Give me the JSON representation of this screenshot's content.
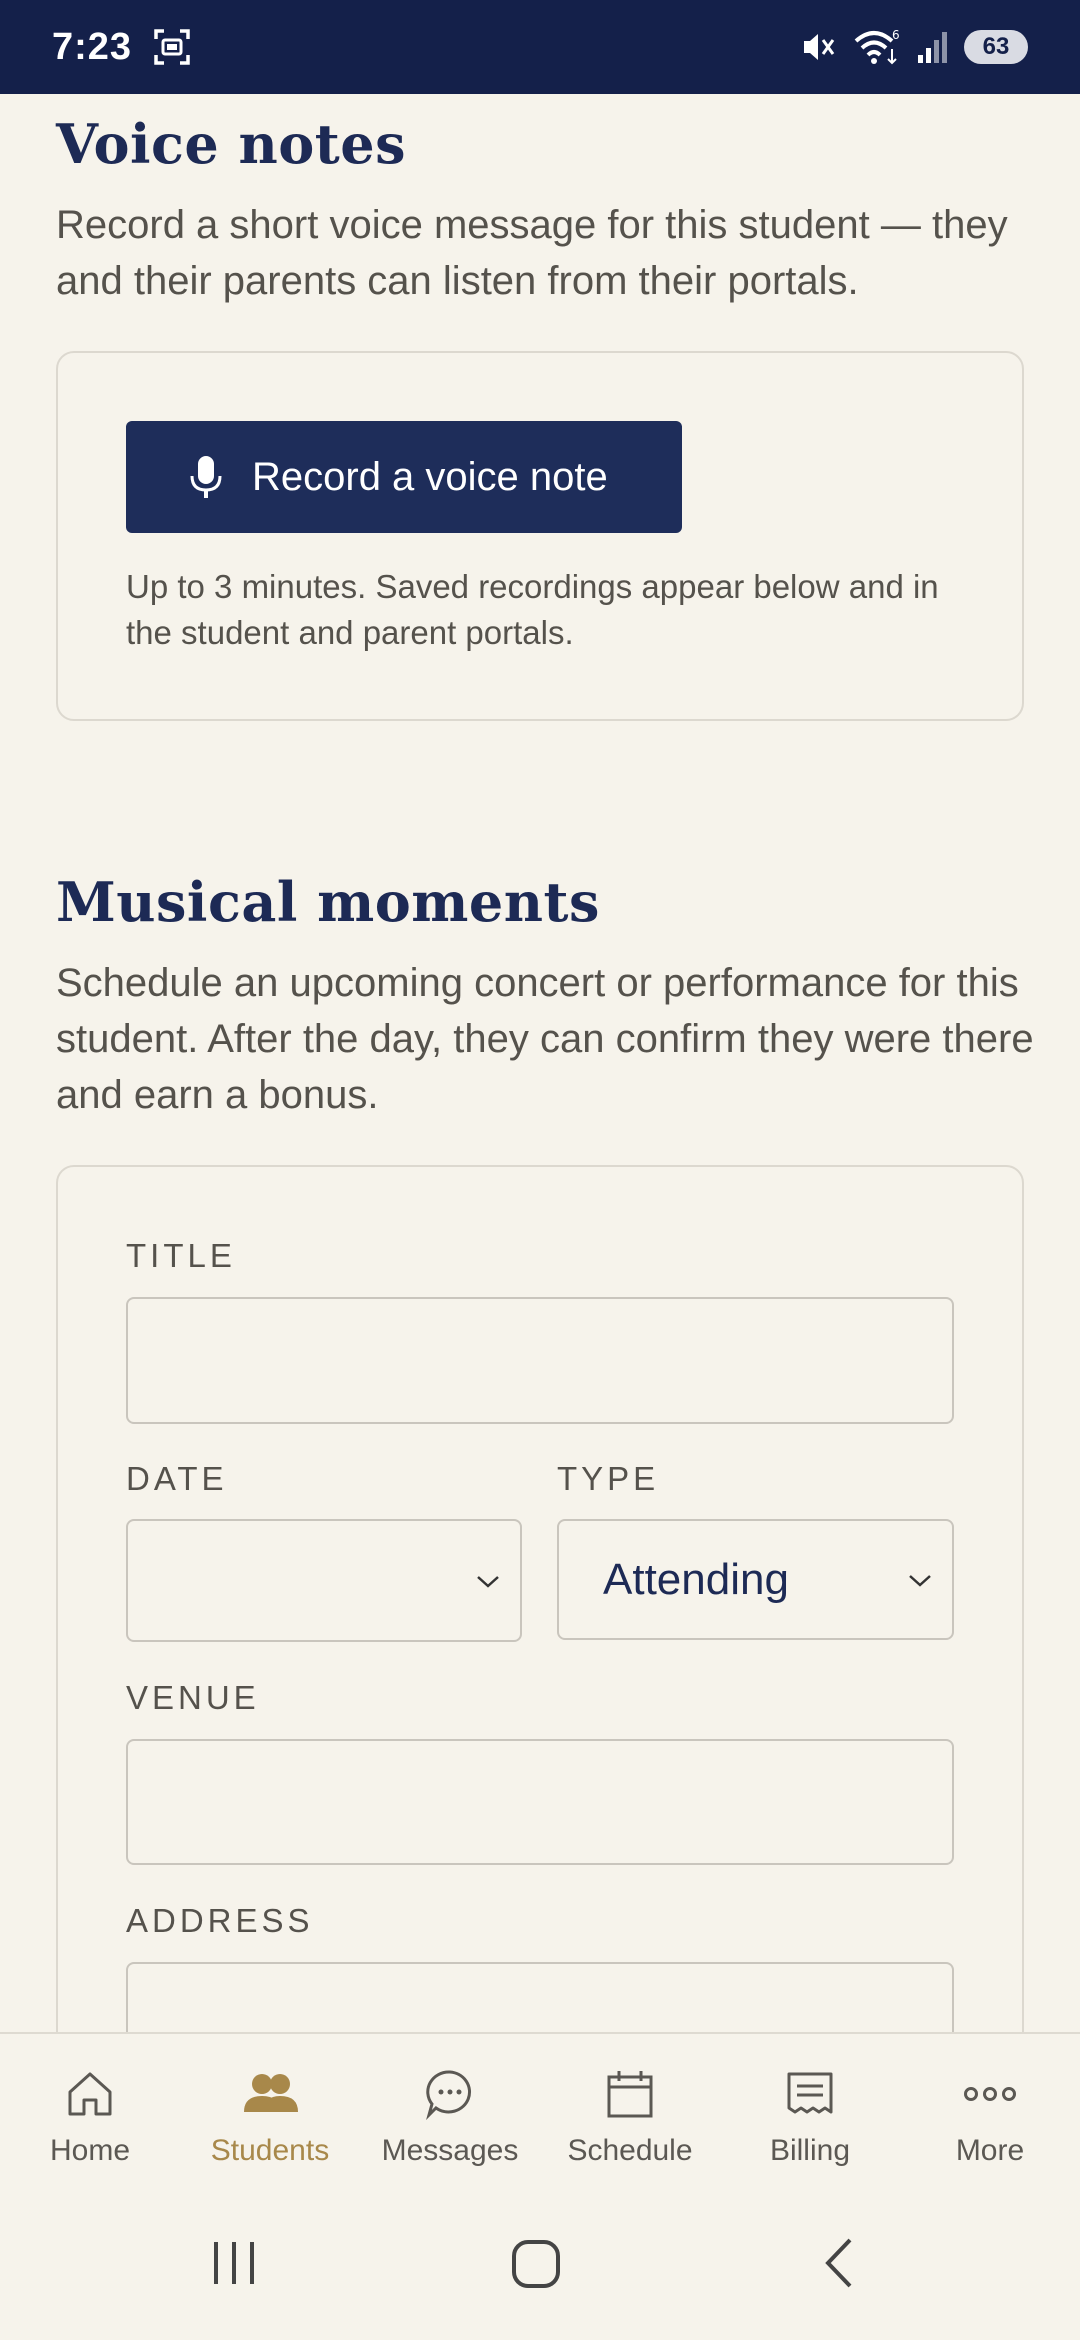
{
  "status_bar": {
    "time": "7:23",
    "battery": "63"
  },
  "voice_notes": {
    "title": "Voice notes",
    "description": "Record a short voice message for this student — they and their parents can listen from their portals.",
    "record_button": "Record a voice note",
    "hint": "Up to 3 minutes. Saved recordings appear below and in the student and parent portals."
  },
  "musical_moments": {
    "title": "Musical moments",
    "description": "Schedule an upcoming concert or performance for this student. After the day, they can confirm they were there and earn a bonus.",
    "form": {
      "title_label": "TITLE",
      "title_value": "",
      "date_label": "DATE",
      "date_value": "",
      "type_label": "TYPE",
      "type_value": "Attending",
      "venue_label": "VENUE",
      "venue_value": "",
      "address_label": "ADDRESS",
      "address_value": ""
    }
  },
  "bottom_nav": {
    "items": [
      {
        "label": "Home",
        "icon": "home-icon"
      },
      {
        "label": "Students",
        "icon": "students-icon",
        "active": true
      },
      {
        "label": "Messages",
        "icon": "messages-icon"
      },
      {
        "label": "Schedule",
        "icon": "calendar-icon"
      },
      {
        "label": "Billing",
        "icon": "billing-icon"
      },
      {
        "label": "More",
        "icon": "more-icon"
      }
    ]
  },
  "colors": {
    "navy": "#1d2a55",
    "background": "#f6f3eb",
    "active_gold": "#a8884a",
    "status_bar": "#14204a"
  }
}
